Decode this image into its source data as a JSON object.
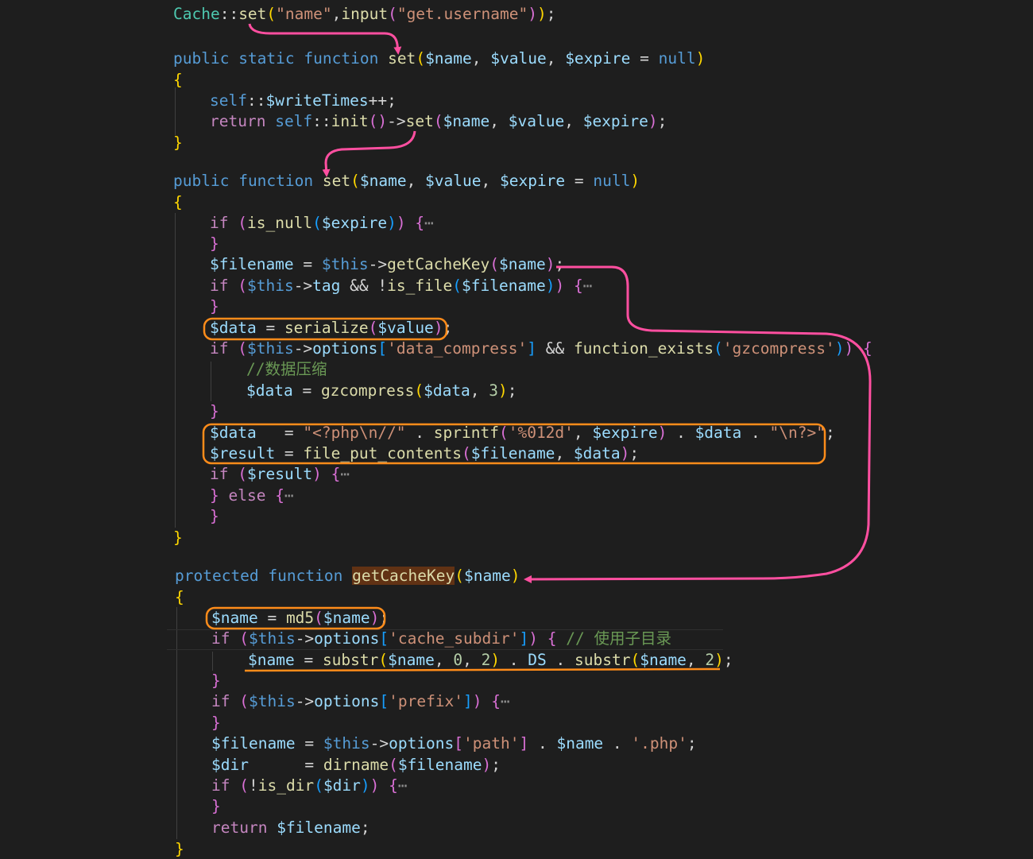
{
  "colors": {
    "background": "#1e1e1e",
    "keyword": "#569cd6",
    "control": "#c586c0",
    "function": "#dcdcaa",
    "variable": "#9cdcfe",
    "string": "#ce9178",
    "number": "#b5cea8",
    "comment": "#6a9955",
    "annotation_arrow": "#ff4fa0",
    "annotation_box": "#ff8c1a"
  },
  "code": {
    "call_class": "Cache",
    "call_method": "set",
    "call_arg_name": "\"name\"",
    "call_input": "input",
    "call_input_arg": "\"get.username\"",
    "public": "public",
    "static": "static",
    "function": "function",
    "protected": "protected",
    "set": "set",
    "name": "$name",
    "value": "$value",
    "expire": "$expire",
    "null": "null",
    "self": "self",
    "write_times": "$writeTimes",
    "return": "return",
    "init": "init",
    "if": "if",
    "else": "else",
    "is_null": "is_null",
    "filename": "$filename",
    "this": "$this",
    "get_cache_key": "getCacheKey",
    "tag": "tag",
    "is_file": "is_file",
    "data": "$data",
    "serialize": "serialize",
    "options": "options",
    "data_compress": "'data_compress'",
    "function_exists": "function_exists",
    "gzcompress_str": "'gzcompress'",
    "comment_compress": "//数据压缩",
    "gzcompress": "gzcompress",
    "three": "3",
    "php_open": "\"<?php\\n//\"",
    "sprintf": "sprintf",
    "fmt": "'%012d'",
    "php_close": "\"\\n?>\"",
    "result": "$result",
    "file_put_contents": "file_put_contents",
    "md5": "md5",
    "cache_subdir": "'cache_subdir'",
    "comment_subdir": "// 使用子目录",
    "substr": "substr",
    "zero": "0",
    "two": "2",
    "ds": "DS",
    "prefix": "'prefix'",
    "path": "'path'",
    "php_ext": "'.php'",
    "dir": "$dir",
    "dirname": "dirname",
    "is_dir": "is_dir",
    "ellipsis": "⋯"
  }
}
